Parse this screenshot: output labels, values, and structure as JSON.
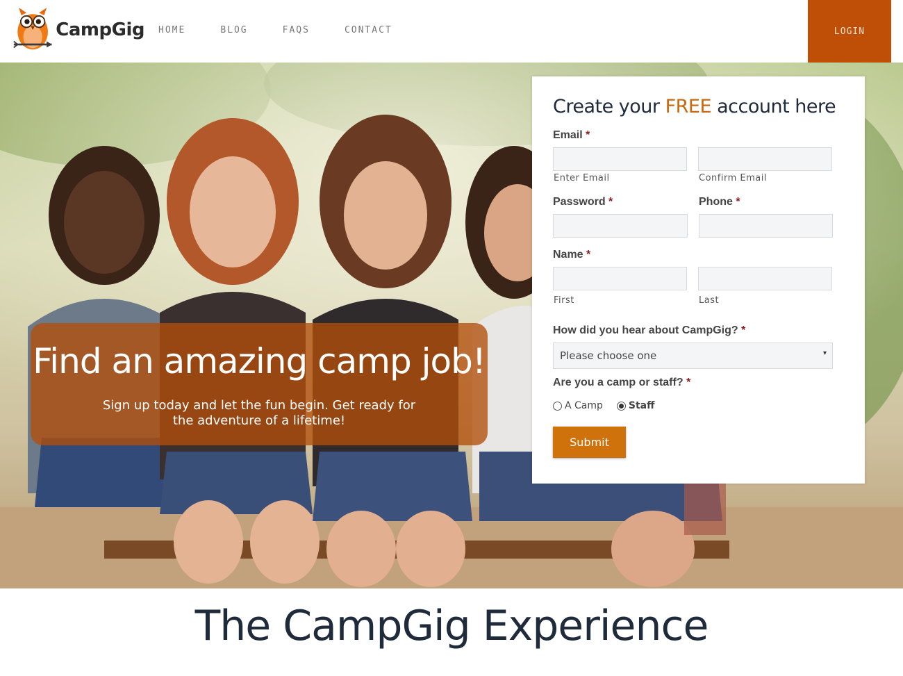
{
  "header": {
    "logo_text": "CampGig",
    "nav": [
      "HOME",
      "BLOG",
      "FAQS",
      "CONTACT"
    ],
    "login_label": "LOGIN"
  },
  "hero": {
    "headline": "Find an amazing camp job!",
    "subline": "Sign up today and let the fun begin. Get ready for the adventure of a lifetime!"
  },
  "form": {
    "title_before": "Create your ",
    "title_free": "FREE",
    "title_after": " account here",
    "required_mark": "*",
    "email_label": "Email",
    "email_hint": "Enter Email",
    "confirm_email_hint": "Confirm Email",
    "password_label": "Password",
    "phone_label": "Phone",
    "name_label": "Name",
    "first_hint": "First",
    "last_hint": "Last",
    "hear_label": "How did you hear about CampGig?",
    "hear_selected": "Please choose one",
    "role_label": "Are you a camp or staff?",
    "role_options": [
      "A Camp",
      "Staff"
    ],
    "role_selected": "Staff",
    "submit_label": "Submit"
  },
  "section": {
    "experience_title": "The CampGig Experience"
  },
  "colors": {
    "brand_orange": "#bf4e06",
    "accent_orange": "#c9680c",
    "heading_navy": "#1f2a3a"
  }
}
